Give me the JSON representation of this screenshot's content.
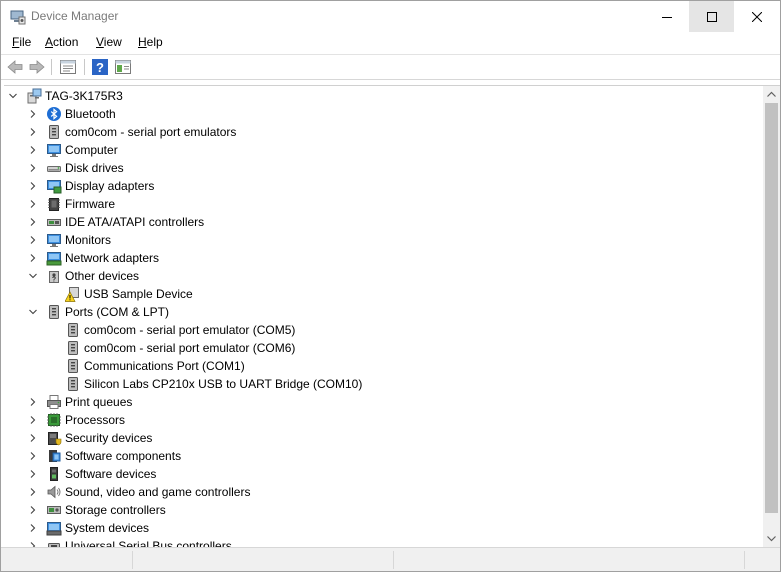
{
  "window": {
    "title": "Device Manager",
    "minimize_glyph": "–",
    "maximize_glyph": "☐",
    "close_glyph": "✕"
  },
  "menu": [
    {
      "label": "File",
      "accel": "F"
    },
    {
      "label": "Action",
      "accel": "A"
    },
    {
      "label": "View",
      "accel": "V"
    },
    {
      "label": "Help",
      "accel": "H"
    }
  ],
  "toolbar": {
    "buttons": [
      "back-icon",
      "forward-icon",
      "properties-icon",
      "help-icon",
      "show-hide-pane-icon"
    ]
  },
  "tree": {
    "root": {
      "label": "TAG-3K175R3",
      "icon": "computer-root-icon",
      "expanded": true
    },
    "categories": [
      {
        "label": "Bluetooth",
        "icon": "bluetooth-icon",
        "expanded": false,
        "children": []
      },
      {
        "label": "com0com - serial port emulators",
        "icon": "serial-port-icon",
        "expanded": false,
        "children": []
      },
      {
        "label": "Computer",
        "icon": "computer-icon",
        "expanded": false,
        "children": []
      },
      {
        "label": "Disk drives",
        "icon": "disk-drive-icon",
        "expanded": false,
        "children": []
      },
      {
        "label": "Display adapters",
        "icon": "display-adapter-icon",
        "expanded": false,
        "children": []
      },
      {
        "label": "Firmware",
        "icon": "firmware-icon",
        "expanded": false,
        "children": []
      },
      {
        "label": "IDE ATA/ATAPI controllers",
        "icon": "ide-controller-icon",
        "expanded": false,
        "children": []
      },
      {
        "label": "Monitors",
        "icon": "monitor-icon",
        "expanded": false,
        "children": []
      },
      {
        "label": "Network adapters",
        "icon": "network-adapter-icon",
        "expanded": false,
        "children": []
      },
      {
        "label": "Other devices",
        "icon": "other-devices-icon",
        "expanded": true,
        "children": [
          {
            "label": "USB Sample Device",
            "icon": "warning-device-icon"
          }
        ]
      },
      {
        "label": "Ports (COM & LPT)",
        "icon": "port-icon",
        "expanded": true,
        "children": [
          {
            "label": "com0com - serial port emulator (COM5)",
            "icon": "port-icon"
          },
          {
            "label": "com0com - serial port emulator (COM6)",
            "icon": "port-icon"
          },
          {
            "label": "Communications Port (COM1)",
            "icon": "port-icon"
          },
          {
            "label": "Silicon Labs CP210x USB to UART Bridge (COM10)",
            "icon": "port-icon"
          }
        ]
      },
      {
        "label": "Print queues",
        "icon": "printer-icon",
        "expanded": false,
        "children": []
      },
      {
        "label": "Processors",
        "icon": "processor-icon",
        "expanded": false,
        "children": []
      },
      {
        "label": "Security devices",
        "icon": "security-device-icon",
        "expanded": false,
        "children": []
      },
      {
        "label": "Software components",
        "icon": "software-component-icon",
        "expanded": false,
        "children": []
      },
      {
        "label": "Software devices",
        "icon": "software-device-icon",
        "expanded": false,
        "children": []
      },
      {
        "label": "Sound, video and game controllers",
        "icon": "speaker-icon",
        "expanded": false,
        "children": []
      },
      {
        "label": "Storage controllers",
        "icon": "storage-controller-icon",
        "expanded": false,
        "children": []
      },
      {
        "label": "System devices",
        "icon": "system-device-icon",
        "expanded": false,
        "children": []
      },
      {
        "label": "Universal Serial Bus controllers",
        "icon": "usb-controller-icon",
        "expanded": false,
        "children": []
      }
    ]
  },
  "colors": {
    "accent": "#0078d7",
    "selection": "#cce8ff",
    "chrome": "#f0f0f0"
  }
}
